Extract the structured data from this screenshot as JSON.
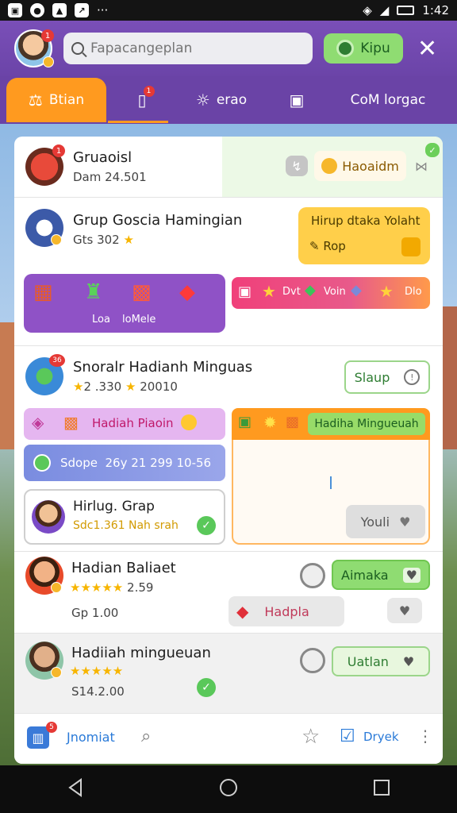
{
  "status": {
    "time": "1:42"
  },
  "header": {
    "avatar_badge": "1",
    "search_placeholder": "Fapacangeplan",
    "kipu_label": "Kipu"
  },
  "tabs": [
    {
      "label": "Btian",
      "active": true
    },
    {
      "label": "",
      "badge": "1"
    },
    {
      "label": "erao"
    },
    {
      "label": ""
    },
    {
      "label": "CoM lorgac"
    }
  ],
  "rows": {
    "r1": {
      "title": "Gruaoisl",
      "sub": "Dam 24.501",
      "badge": "1",
      "btn": "Haoaidm"
    },
    "r2": {
      "title": "Grup Goscia Hamingian",
      "sub": "Gts 302",
      "card_title": "Hirup dtaka Yolaht",
      "card_btn": "Rop"
    },
    "r2_tiles": {
      "left": [
        "Loa",
        "loMele"
      ],
      "right": [
        "Dvt",
        "Voin",
        "Dlo"
      ]
    },
    "r3": {
      "title": "Snoralr Hadianh Minguas",
      "badge": "36",
      "sub": "2 .330",
      "sub2": "20010",
      "btn": "Slaup"
    },
    "r3_cards": {
      "left_top": "Hadiah Piaoin",
      "left_mid": "Sdope  26y 21 299 10-56",
      "right_top": "Hadiha Mingueuah",
      "right_btn": "Youli"
    },
    "r3_sub": {
      "title": "Hirlug. Grap",
      "sub": "Sdc1.361 Nah srah"
    },
    "r4": {
      "title": "Hadian Baliaet",
      "rating": "2.59",
      "sub": "Gp 1.00",
      "btn": "Aimaka",
      "badge_label": "Hadpla"
    },
    "r5": {
      "title": "Hadiiah mingueuan",
      "sub": "S14.2.00",
      "btn": "Uatlan"
    }
  },
  "bottom": {
    "left": "Jnomiat",
    "right": "Dryek",
    "badge": "5"
  },
  "colors": {
    "purple": "#6a43a6",
    "orange": "#ff9a1f",
    "green": "#8fdc72",
    "yellow": "#ffcf4a"
  }
}
